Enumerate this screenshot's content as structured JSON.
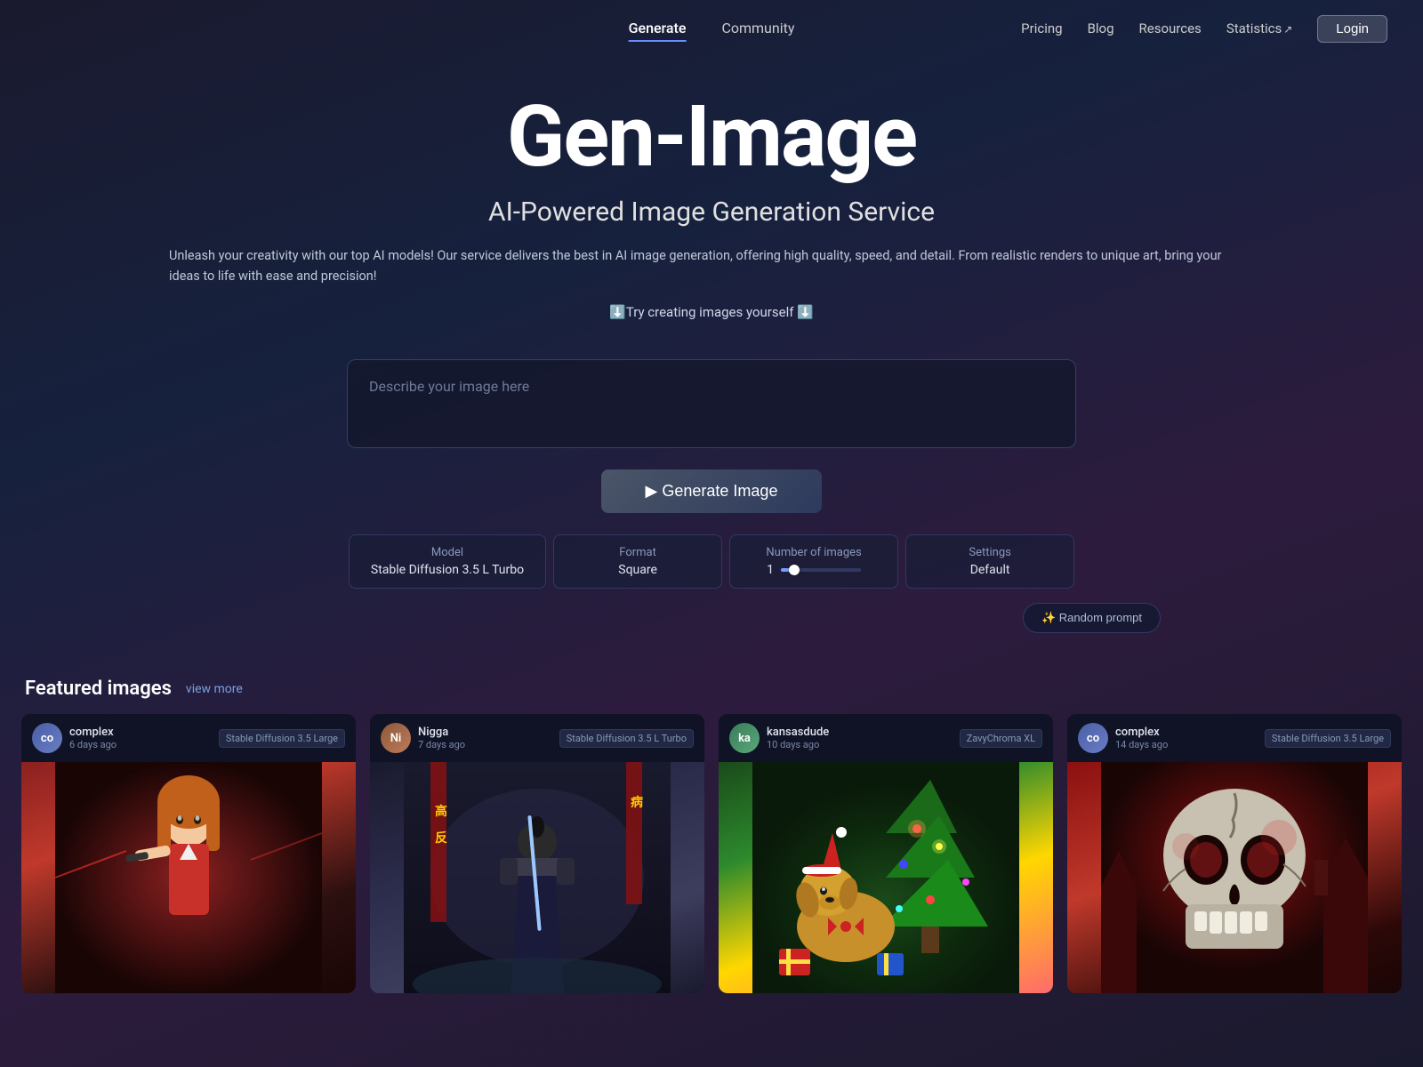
{
  "nav": {
    "links": [
      {
        "label": "Generate",
        "active": true
      },
      {
        "label": "Community",
        "active": false
      }
    ],
    "rightLinks": [
      {
        "label": "Pricing",
        "hasIcon": false
      },
      {
        "label": "Blog",
        "hasIcon": false
      },
      {
        "label": "Resources",
        "hasIcon": false
      },
      {
        "label": "Statistics",
        "hasIcon": true
      }
    ],
    "loginLabel": "Login"
  },
  "hero": {
    "title": "Gen-Image",
    "subtitle": "AI-Powered Image Generation Service",
    "description": "Unleash your creativity with our top AI models! Our service delivers the best in AI image generation, offering high quality, speed, and detail. From realistic renders to unique art, bring your ideas to life with ease and precision!",
    "ctaText": "⬇️Try creating images yourself ⬇️"
  },
  "prompt": {
    "placeholder": "Describe your image here",
    "value": ""
  },
  "generateBtn": {
    "label": "▶ Generate Image"
  },
  "options": {
    "model": {
      "label": "Model",
      "value": "Stable Diffusion 3.5 L Turbo"
    },
    "format": {
      "label": "Format",
      "value": "Square"
    },
    "numImages": {
      "label": "Number of images",
      "value": "1",
      "sliderMin": 1,
      "sliderMax": 10,
      "sliderCurrent": 1
    },
    "settings": {
      "label": "Settings",
      "value": "Default"
    }
  },
  "randomPrompt": {
    "label": "✨ Random prompt"
  },
  "featured": {
    "title": "Featured images",
    "viewMore": "view more",
    "images": [
      {
        "username": "complex",
        "timeAgo": "6 days ago",
        "model": "Stable Diffusion 3.5 Large",
        "avatarText": "co",
        "avatarColor": "#4a5ea5",
        "type": "anime"
      },
      {
        "username": "Nigga",
        "timeAgo": "7 days ago",
        "model": "Stable Diffusion 3.5 L Turbo",
        "avatarText": "Ni",
        "avatarColor": "#8a5a3a",
        "type": "samurai"
      },
      {
        "username": "kansasdude",
        "timeAgo": "10 days ago",
        "model": "ZavyChroma XL",
        "avatarText": "ka",
        "avatarColor": "#3a7a5a",
        "type": "dog"
      },
      {
        "username": "complex",
        "timeAgo": "14 days ago",
        "model": "Stable Diffusion 3.5 Large",
        "avatarText": "co",
        "avatarColor": "#4a5ea5",
        "type": "skull"
      }
    ]
  }
}
